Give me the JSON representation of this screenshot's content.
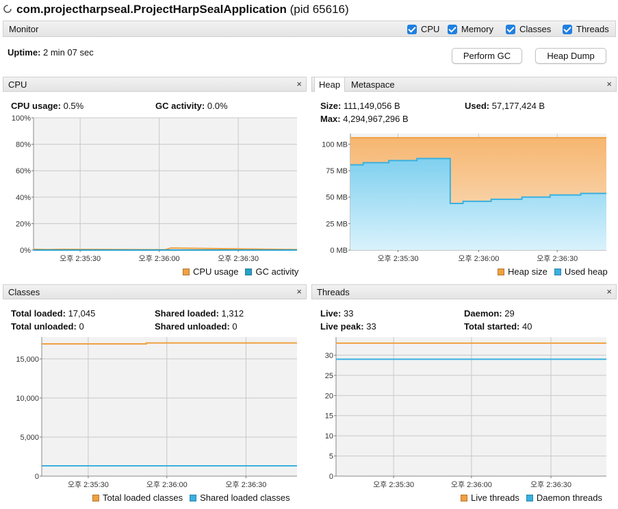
{
  "window": {
    "app_name": "com.projectharpseal.ProjectHarpSealApplication",
    "pid_text": "(pid 65616)"
  },
  "monitor": {
    "label": "Monitor",
    "checkboxes": [
      {
        "label": "CPU",
        "checked": true
      },
      {
        "label": "Memory",
        "checked": true
      },
      {
        "label": "Classes",
        "checked": true
      },
      {
        "label": "Threads",
        "checked": true
      }
    ],
    "uptime_label": "Uptime:",
    "uptime_value": "2 min 07 sec",
    "perform_gc": "Perform GC",
    "heap_dump": "Heap Dump"
  },
  "colors": {
    "orange": "#f0a040",
    "blue": "#3ab0e0",
    "grid": "#c8c8c8",
    "plot_bg": "#f2f2f2"
  },
  "cpu": {
    "title": "CPU",
    "close": "×",
    "usage_label": "CPU usage:",
    "usage_value": "0.5%",
    "gc_label": "GC activity:",
    "gc_value": "0.0%",
    "legend": [
      "CPU usage",
      "GC activity"
    ],
    "chart_data": {
      "type": "line",
      "y_ticks": [
        "100%",
        "80%",
        "60%",
        "40%",
        "20%",
        "0%"
      ],
      "ylim": [
        0,
        100
      ],
      "x_ticks": [
        "오후 2:35:30",
        "오후 2:36:00",
        "오후 2:36:30"
      ],
      "series": [
        {
          "name": "CPU usage",
          "color": "#f0a040",
          "x": [
            0,
            0.05,
            0.1,
            0.5,
            0.52,
            1
          ],
          "values": [
            0.6,
            0.3,
            0.5,
            0.2,
            1.5,
            0.3
          ]
        },
        {
          "name": "GC activity",
          "color": "#2aa0c8",
          "x": [
            0,
            1
          ],
          "values": [
            0,
            0
          ]
        }
      ]
    }
  },
  "heap": {
    "tabs": [
      "Heap",
      "Metaspace"
    ],
    "close": "×",
    "size_label": "Size:",
    "size_value": "111,149,056 B",
    "used_label": "Used:",
    "used_value": "57,177,424 B",
    "max_label": "Max:",
    "max_value": "4,294,967,296 B",
    "legend": [
      "Heap size",
      "Used heap"
    ],
    "chart_data": {
      "type": "area",
      "y_ticks": [
        "100 MB",
        "75 MB",
        "50 MB",
        "25 MB",
        "0 MB"
      ],
      "ylim": [
        0,
        110
      ],
      "x_ticks": [
        "오후 2:35:30",
        "오후 2:36:00",
        "오후 2:36:30"
      ],
      "series": [
        {
          "name": "Heap size",
          "color": "#f0a040",
          "steps": [
            [
              0,
              106
            ],
            [
              1,
              106
            ]
          ]
        },
        {
          "name": "Used heap",
          "color": "#3ab0e0",
          "steps": [
            [
              0,
              80.5
            ],
            [
              0.05,
              82.5
            ],
            [
              0.15,
              84.5
            ],
            [
              0.26,
              86.5
            ],
            [
              0.39,
              44
            ],
            [
              0.44,
              46
            ],
            [
              0.55,
              48
            ],
            [
              0.67,
              50
            ],
            [
              0.78,
              52
            ],
            [
              0.9,
              53.5
            ],
            [
              1,
              53.5
            ]
          ]
        }
      ]
    }
  },
  "classes": {
    "title": "Classes",
    "close": "×",
    "total_loaded_label": "Total loaded:",
    "total_loaded_value": "17,045",
    "shared_loaded_label": "Shared loaded:",
    "shared_loaded_value": "1,312",
    "total_unloaded_label": "Total unloaded:",
    "total_unloaded_value": "0",
    "shared_unloaded_label": "Shared unloaded:",
    "shared_unloaded_value": "0",
    "legend": [
      "Total loaded classes",
      "Shared loaded classes"
    ],
    "chart_data": {
      "type": "line",
      "y_ticks": [
        "15,000",
        "10,000",
        "5,000",
        "0"
      ],
      "ylim": [
        0,
        17800
      ],
      "x_ticks": [
        "오후 2:35:30",
        "오후 2:36:00",
        "오후 2:36:30"
      ],
      "series": [
        {
          "name": "Total loaded classes",
          "color": "#f0a040",
          "steps": [
            [
              0,
              16920
            ],
            [
              0.41,
              17045
            ],
            [
              1,
              17045
            ]
          ]
        },
        {
          "name": "Shared loaded classes",
          "color": "#3ab0e0",
          "steps": [
            [
              0,
              1312
            ],
            [
              1,
              1312
            ]
          ]
        }
      ]
    }
  },
  "threads": {
    "title": "Threads",
    "close": "×",
    "live_label": "Live:",
    "live_value": "33",
    "daemon_label": "Daemon:",
    "daemon_value": "29",
    "peak_label": "Live peak:",
    "peak_value": "33",
    "started_label": "Total started:",
    "started_value": "40",
    "legend": [
      "Live threads",
      "Daemon threads"
    ],
    "chart_data": {
      "type": "line",
      "y_ticks": [
        "30",
        "25",
        "20",
        "15",
        "10",
        "5",
        "0"
      ],
      "ylim": [
        0,
        34.5
      ],
      "x_ticks": [
        "오후 2:35:30",
        "오후 2:36:00",
        "오후 2:36:30"
      ],
      "series": [
        {
          "name": "Live threads",
          "color": "#f0a040",
          "steps": [
            [
              0,
              33
            ],
            [
              1,
              33
            ]
          ]
        },
        {
          "name": "Daemon threads",
          "color": "#3ab0e0",
          "steps": [
            [
              0,
              29
            ],
            [
              1,
              29
            ]
          ]
        }
      ]
    }
  }
}
